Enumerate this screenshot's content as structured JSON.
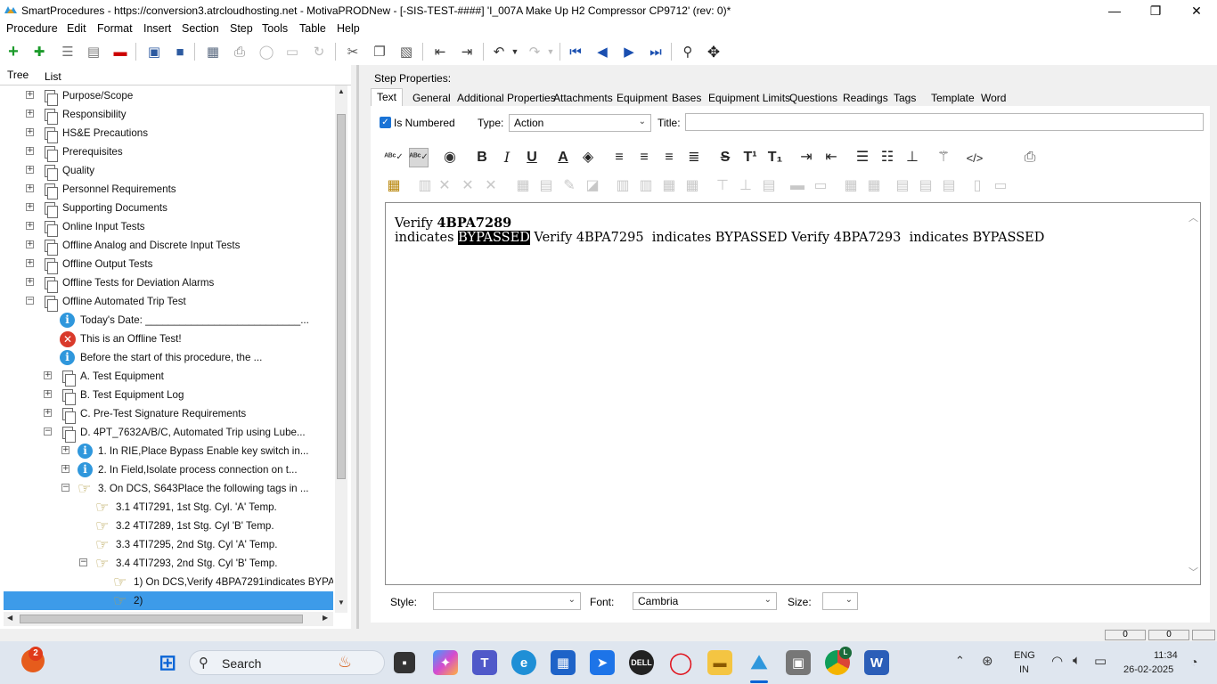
{
  "window": {
    "title": "SmartProcedures - https://conversion3.atrcloudhosting.net - MotivaPRODNew - [-SIS-TEST-####] 'I_007A Make Up H2 Compressor CP9712' (rev: 0)*",
    "minimize": "—",
    "maximize": "❐",
    "close": "✕"
  },
  "menu": {
    "items": [
      "Procedure",
      "Edit",
      "Format",
      "Insert",
      "Section",
      "Step",
      "Tools",
      "Table",
      "Help"
    ]
  },
  "toolbar": {
    "icons": [
      "add-icon",
      "add-child-icon",
      "list-icon",
      "list-alt-icon",
      "remove-icon",
      "save-copy-icon",
      "save-icon",
      "publish-icon",
      "print-icon",
      "circle-icon",
      "window-icon",
      "redo-arrow-icon",
      "cut-icon",
      "copy-icon",
      "paste-icon",
      "indent-icon",
      "outdent-icon",
      "undo-icon",
      "undo-dropdown-icon",
      "redo-icon",
      "redo-dropdown-icon",
      "first-icon",
      "previous-icon",
      "next-icon",
      "last-icon",
      "binoculars-icon",
      "move-icon"
    ]
  },
  "left_panel": {
    "tabs": [
      "Tree",
      "List"
    ],
    "tree": [
      {
        "label": "Purpose/Scope",
        "level": 0,
        "icon": "doc",
        "expander": "+"
      },
      {
        "label": "Responsibility",
        "level": 0,
        "icon": "doc",
        "expander": "+"
      },
      {
        "label": "HS&E Precautions",
        "level": 0,
        "icon": "doc",
        "expander": "+"
      },
      {
        "label": "Prerequisites",
        "level": 0,
        "icon": "doc",
        "expander": "+"
      },
      {
        "label": "Quality",
        "level": 0,
        "icon": "doc",
        "expander": "+"
      },
      {
        "label": "Personnel Requirements",
        "level": 0,
        "icon": "doc",
        "expander": "+"
      },
      {
        "label": "Supporting Documents",
        "level": 0,
        "icon": "doc",
        "expander": "+"
      },
      {
        "label": "Online Input Tests",
        "level": 0,
        "icon": "doc",
        "expander": "+"
      },
      {
        "label": "Offline Analog and Discrete Input Tests",
        "level": 0,
        "icon": "doc",
        "expander": "+"
      },
      {
        "label": "Offline Output Tests",
        "level": 0,
        "icon": "doc",
        "expander": "+"
      },
      {
        "label": "Offline Tests for Deviation Alarms",
        "level": 0,
        "icon": "doc",
        "expander": "+"
      },
      {
        "label": "Offline Automated Trip Test",
        "level": 0,
        "icon": "doc",
        "expander": "−"
      },
      {
        "label": "Today's Date: ___________________________...",
        "level": 1,
        "icon": "info",
        "expander": ""
      },
      {
        "label": "This is an Offline Test!",
        "level": 1,
        "icon": "error",
        "expander": ""
      },
      {
        "label": "Before the start of this procedure, the ...",
        "level": 1,
        "icon": "info",
        "expander": ""
      },
      {
        "label": "A. Test Equipment",
        "level": 1,
        "icon": "doc",
        "expander": "+"
      },
      {
        "label": "B. Test Equipment Log",
        "level": 1,
        "icon": "doc",
        "expander": "+"
      },
      {
        "label": "C. Pre-Test Signature Requirements",
        "level": 1,
        "icon": "doc",
        "expander": "+"
      },
      {
        "label": "D. 4PT_7632A/B/C, Automated Trip using Lube...",
        "level": 1,
        "icon": "doc",
        "expander": "−"
      },
      {
        "label": "1. In RIE,Place Bypass Enable key switch in...",
        "level": 2,
        "icon": "info",
        "expander": "+"
      },
      {
        "label": "2. In Field,Isolate process connection on t...",
        "level": 2,
        "icon": "info",
        "expander": "+"
      },
      {
        "label": "3. On DCS, S643Place the following tags in ...",
        "level": 2,
        "icon": "hand",
        "expander": "−"
      },
      {
        "label": "3.1 4TI7291, 1st Stg. Cyl. 'A' Temp.",
        "level": 3,
        "icon": "hand",
        "expander": ""
      },
      {
        "label": "3.2 4TI7289, 1st Stg. Cyl 'B' Temp.",
        "level": 3,
        "icon": "hand",
        "expander": ""
      },
      {
        "label": "3.3 4TI7295, 2nd Stg. Cyl 'A' Temp.",
        "level": 3,
        "icon": "hand",
        "expander": ""
      },
      {
        "label": "3.4 4TI7293, 2nd Stg. Cyl 'B' Temp.",
        "level": 3,
        "icon": "hand",
        "expander": "−"
      },
      {
        "label": "1) On DCS,Verify 4BPA7291indicates BYPA...",
        "level": 4,
        "icon": "hand",
        "expander": ""
      },
      {
        "label": "2)",
        "level": 4,
        "icon": "hand",
        "expander": "",
        "selected": true
      }
    ]
  },
  "step_properties": {
    "heading": "Step Properties:",
    "tabs": [
      "Text",
      "General",
      "Additional Properties",
      "Attachments",
      "Equipment",
      "Bases",
      "Equipment Limits",
      "Questions",
      "Readings",
      "Tags",
      "Template",
      "Word"
    ],
    "active_tab": "Text",
    "is_numbered_label": "Is Numbered",
    "is_numbered_checked": true,
    "type_label": "Type:",
    "type_value": "Action",
    "title_label": "Title:",
    "title_value": "",
    "editor": {
      "line1_prefix": "Verify ",
      "line1_bold": "4BPA7289",
      "line2_before": "indicates ",
      "line2_highlight": "BYPASSED",
      "line2_after": " Verify 4BPA7295  indicates BYPASSED Verify 4BPA7293  indicates BYPASSED"
    },
    "style_label": "Style:",
    "style_value": "",
    "font_label": "Font:",
    "font_value": "Cambria",
    "size_label": "Size:",
    "size_value": ""
  },
  "statusbar": {
    "cell1": "0",
    "cell2": "0"
  },
  "taskbar": {
    "notification_count": "2",
    "search_placeholder": "Search",
    "lang_top": "ENG",
    "lang_bottom": "IN",
    "time": "11:34",
    "date": "26-02-2025",
    "chrome_badge": "L"
  },
  "colors": {
    "selection": "#3d9be9",
    "info_blue": "#2f97dc",
    "error_red": "#d93a2b",
    "accent": "#1a73d6",
    "taskbar": "#dfe6ef"
  }
}
